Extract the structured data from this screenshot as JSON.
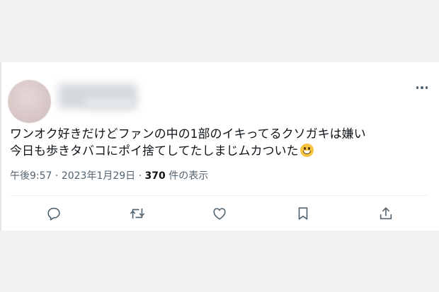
{
  "tweet": {
    "text_line_1": "ワンオク好きだけどファンの中の1部のイキってるクソガキは嫌い",
    "text_line_2": "今日も歩きタバコにポイ捨てしてたしまじムカついた",
    "emoji": "grinning-face-with-smiling-eyes",
    "time": "午後9:57",
    "date": "2023年1月29日",
    "separator": "·",
    "views_count": "370",
    "views_label": "件の表示"
  },
  "icons": {
    "more": "more-horizontal-icon",
    "reply": "reply-icon",
    "retweet": "retweet-icon",
    "like": "heart-icon",
    "bookmark": "bookmark-icon",
    "share": "share-icon"
  },
  "colors": {
    "text": "#0f1419",
    "secondary": "#536471",
    "divider": "#eff3f4"
  }
}
